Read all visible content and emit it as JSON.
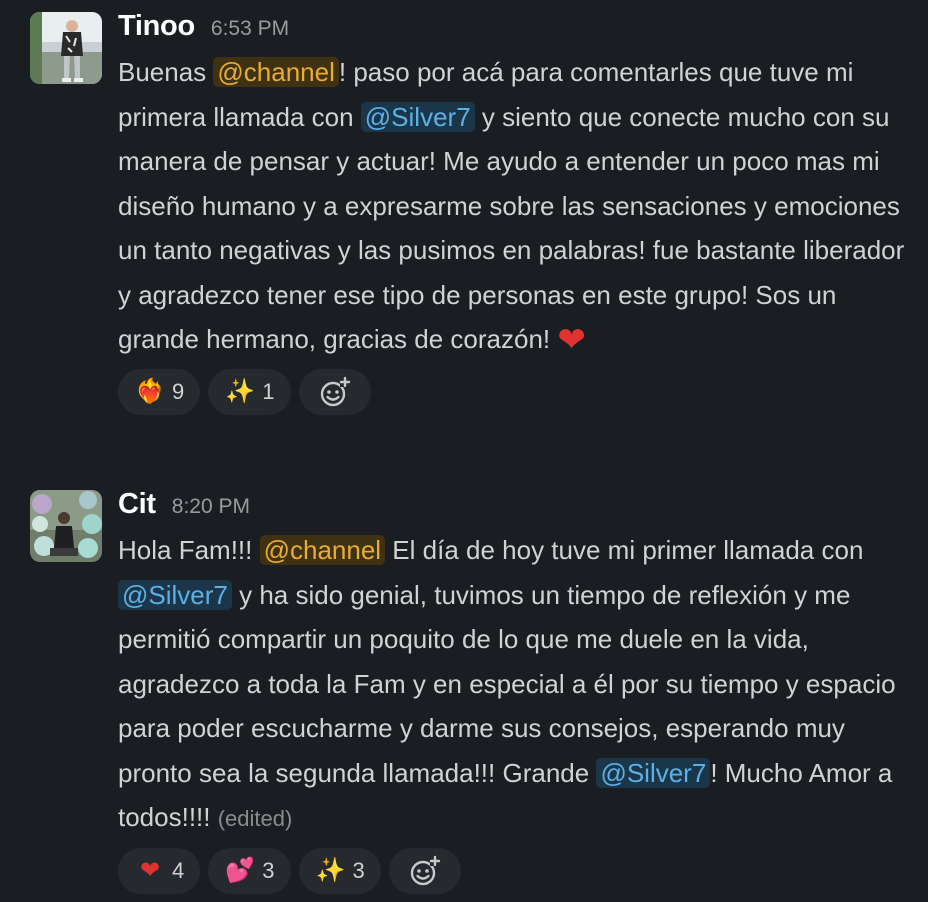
{
  "messages": [
    {
      "author": "Tinoo",
      "time": "6:53 PM",
      "avatar_icon": "user-photo-avatar",
      "segments": [
        "Buenas ",
        "@channel",
        "! paso por acá para comentarles que tuve mi primera llamada con ",
        "@Silver7",
        " y siento que conecte mucho con su manera de pensar y actuar! Me ayudo a entender un poco mas mi diseño humano y a expresarme sobre las sensaciones y emociones un tanto negativas y las pusimos en palabras! fue bastante liberador y agradezco tener ese tipo de personas en este grupo! Sos un grande hermano, gracias de corazón! ",
        "❤"
      ],
      "reactions": [
        {
          "icon": "heart-on-fire-emoji",
          "glyph": "❤‍🔥",
          "count": "9"
        },
        {
          "icon": "sparkles-emoji",
          "glyph": "✨",
          "count": "1"
        }
      ]
    },
    {
      "author": "Cit",
      "time": "8:20 PM",
      "avatar_icon": "user-photo-avatar",
      "segments": [
        "Hola Fam!!! ",
        "@channel",
        " El día de hoy tuve mi primer llamada con ",
        "@Silver7",
        " y ha sido genial, tuvimos un tiempo de reflexión y me permitió compartir un poquito de lo que me duele en la vida, agradezco a toda la Fam y en especial a él por su tiempo y espacio para poder escucharme y darme sus consejos, esperando muy pronto sea la segunda llamada!!! Grande ",
        "@Silver7",
        "! Mucho Amor a todos!!!! ",
        "(edited)"
      ],
      "reactions": [
        {
          "icon": "red-heart-emoji",
          "glyph": "❤",
          "count": "4"
        },
        {
          "icon": "two-hearts-emoji",
          "glyph": "💕",
          "count": "3"
        },
        {
          "icon": "sparkles-emoji",
          "glyph": "✨",
          "count": "3"
        }
      ]
    }
  ],
  "add_reaction_icon": "add-reaction-icon",
  "colors": {
    "background": "#1a1d21",
    "text": "#d1d2d3",
    "channel_mention": "#e8ad32",
    "user_mention": "#5cb0e6",
    "reaction_pill": "#26292e"
  }
}
